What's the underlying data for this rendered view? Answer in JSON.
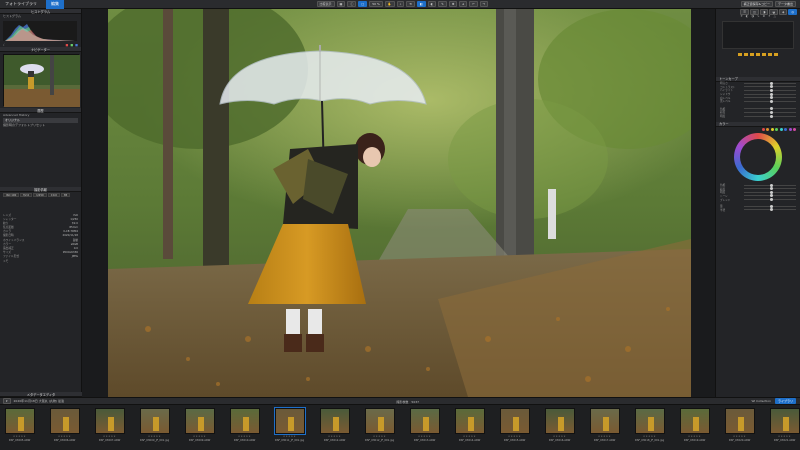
{
  "topbar": {
    "tab_library": "フォトライブラリ",
    "tab_edit": "編集",
    "zoom": "50 %",
    "btn_compare": "比較表示",
    "btn_export_settings": "補正値保存&コピー",
    "btn_export": "データ書出"
  },
  "left": {
    "histogram_title": "ヒストグラム",
    "histogram_sub": "ヒストグラム",
    "nav_title": "ナビゲーター",
    "history_title": "履歴",
    "history_sub": "Advanced History",
    "history_items": [
      "オリジナル",
      "撮影時のデフォルトプリセット"
    ],
    "shooting_title": "撮影情報",
    "meta_rows": [
      {
        "k": "レンズ",
        "v": "ISO"
      },
      {
        "k": "シャッター",
        "v": "1/250"
      },
      {
        "k": "絞り",
        "v": "f/2.0"
      },
      {
        "k": "焦点距離",
        "v": "85mm"
      },
      {
        "k": "カメラ",
        "v": "ILCE-7RM4"
      },
      {
        "k": "撮影日時",
        "v": "2020/11/18"
      },
      {
        "k": "ホワイトバランス",
        "v": "自動"
      },
      {
        "k": "カラー",
        "v": "sRGB"
      },
      {
        "k": "露出補正",
        "v": "0.0"
      },
      {
        "k": "サイズ",
        "v": "9504x6336"
      },
      {
        "k": "ファイル形式",
        "v": "JPEG"
      },
      {
        "k": "メモ",
        "v": ""
      }
    ],
    "footer_title": "メタデータエディタ"
  },
  "photo": {
    "alt": "umbrella portrait"
  },
  "filmbar": {
    "left_label": "2020年11月18日 大阪丸 (丸物) 最適",
    "center_label": "撮影枚数　5037",
    "right_filter": "Wi Collection",
    "right_btn": "ライブラリ"
  },
  "filmstrip": [
    {
      "name": "DSF_03005.ARW",
      "sel": false
    },
    {
      "name": "DSF_03006.ARW",
      "sel": false
    },
    {
      "name": "DSF_03007.ARW",
      "sel": false
    },
    {
      "name": "DSF_03009_JF_001.jpg",
      "sel": false
    },
    {
      "name": "DSF_03009.ARW",
      "sel": false
    },
    {
      "name": "DSF_03010.ARW",
      "sel": false
    },
    {
      "name": "DSF_03011_JF_001.jpg",
      "sel": true
    },
    {
      "name": "DSF_03012.ARW",
      "sel": false
    },
    {
      "name": "DSF_03012_JF_001.jpg",
      "sel": false
    },
    {
      "name": "DSF_03013.ARW",
      "sel": false
    },
    {
      "name": "DSF_03014.ARW",
      "sel": false
    },
    {
      "name": "DSF_03015.ARW",
      "sel": false
    },
    {
      "name": "DSF_03016.ARW",
      "sel": false
    },
    {
      "name": "DSF_03017.ARW",
      "sel": false
    },
    {
      "name": "DSF_03018_JF_001.jpg",
      "sel": false
    },
    {
      "name": "DSF_03019.ARW",
      "sel": false
    },
    {
      "name": "DSF_03020.ARW",
      "sel": false
    },
    {
      "name": "DSF_03021.ARW",
      "sel": false
    }
  ],
  "right": {
    "panel_title": "カラー",
    "tone_label": "トーンカーブ",
    "sliders_a": [
      "明るさ",
      "コントラスト",
      "ハイライト",
      "シャドウ",
      "白レベル",
      "黒レベル"
    ],
    "sliders_b": [
      "色相",
      "彩度",
      "明度"
    ],
    "sliders_c": [
      "色相",
      "彩度",
      "明度",
      "トーン",
      "ブレンド"
    ],
    "sliders_d": [
      "量",
      "半径"
    ]
  },
  "colors": {
    "accent": "#1e6fc9",
    "panel": "#232427",
    "bg": "#1b1c1e"
  }
}
